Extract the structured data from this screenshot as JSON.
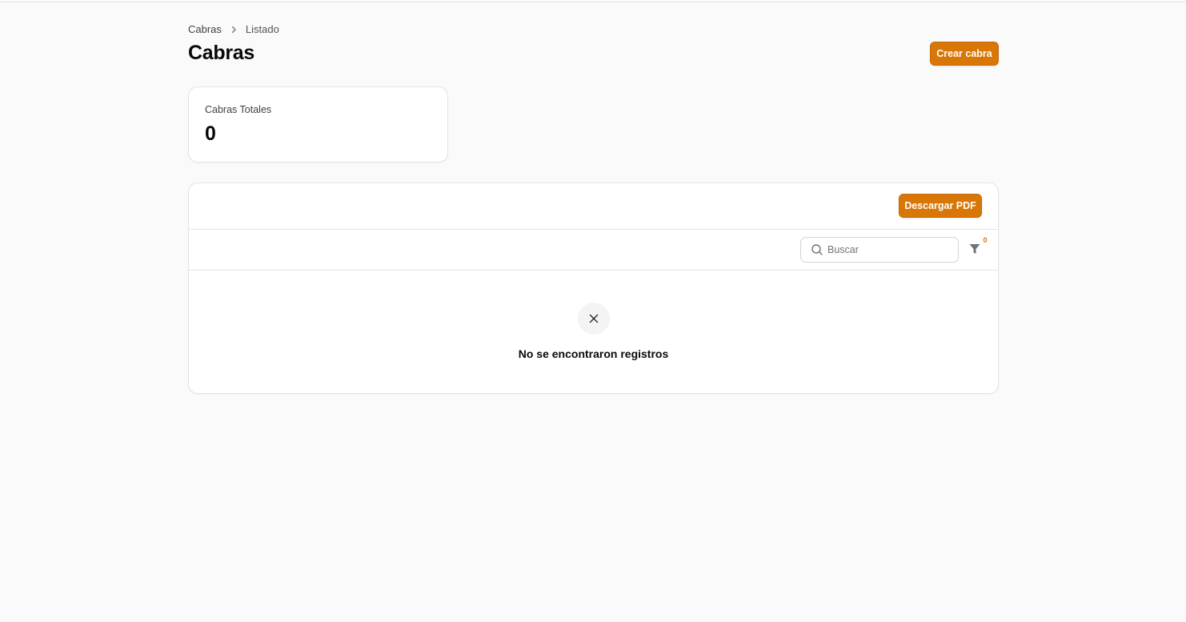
{
  "breadcrumb": {
    "items": [
      "Cabras",
      "Listado"
    ]
  },
  "page": {
    "title": "Cabras",
    "create_button": "Crear cabra"
  },
  "stats": {
    "total_label": "Cabras Totales",
    "total_value": "0"
  },
  "table": {
    "pdf_button": "Descargar PDF",
    "search_placeholder": "Buscar",
    "filter_count": "0",
    "empty_message": "No se encontraron registros"
  },
  "icons": {
    "breadcrumb_separator": "chevron-right-icon",
    "search": "search-icon",
    "filter": "funnel-icon",
    "empty": "x-mark-icon"
  },
  "colors": {
    "primary": "#d97706",
    "background": "#fafafa",
    "card": "#ffffff",
    "border": "#e4e4e7"
  }
}
